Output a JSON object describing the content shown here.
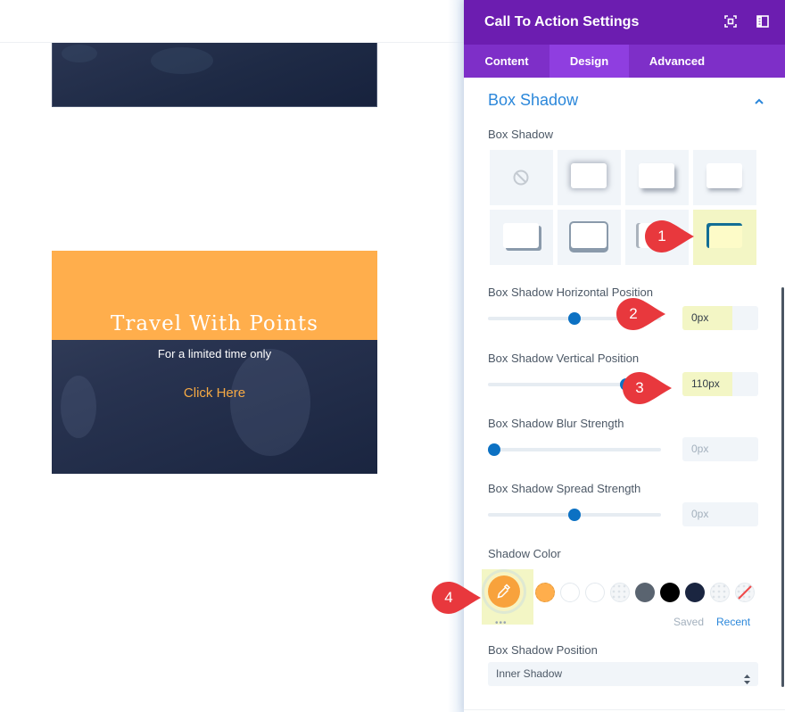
{
  "canvas": {
    "cta": {
      "title": "Travel With Points",
      "subtitle": "For a limited time only",
      "button_label": "Click Here"
    },
    "colors": {
      "shadow_color": "#ffae4c",
      "module_bg": "#1e2a45",
      "button_text": "#f5a944"
    }
  },
  "panel": {
    "title": "Call To Action Settings",
    "header_icons": [
      "expand-icon",
      "sidebar-toggle-icon"
    ],
    "tabs": [
      {
        "label": "Content",
        "active": false
      },
      {
        "label": "Design",
        "active": true
      },
      {
        "label": "Advanced",
        "active": false
      }
    ],
    "section": {
      "title": "Box Shadow",
      "expanded": true,
      "presets_label": "Box Shadow",
      "presets": [
        "none",
        "all-around",
        "bottom-right",
        "bottom",
        "bottom-right-hard",
        "bottom-hard",
        "left-hard",
        "inner-top-left"
      ],
      "selected_preset": 7,
      "horizontal": {
        "label": "Box Shadow Horizontal Position",
        "value": "0px",
        "slider_fraction": 0.5
      },
      "vertical": {
        "label": "Box Shadow Vertical Position",
        "value": "110px",
        "slider_fraction": 0.82
      },
      "blur": {
        "label": "Box Shadow Blur Strength",
        "value": "0px",
        "slider_fraction": 0.0
      },
      "spread": {
        "label": "Box Shadow Spread Strength",
        "value": "0px",
        "slider_fraction": 0.5
      },
      "shadow_color": {
        "label": "Shadow Color",
        "current": "#f8a23c",
        "more_label": "•••",
        "swatches": [
          "#ffae4c",
          "#ffffff",
          "#ffffff",
          "transparent",
          "#5a6470",
          "#000000",
          "#1a2540",
          "transparent",
          "none"
        ],
        "saved_label": "Saved",
        "recent_label": "Recent"
      },
      "position": {
        "label": "Box Shadow Position",
        "value": "Inner Shadow"
      }
    },
    "colors": {
      "header_bg": "#6c1db0",
      "tabs_bg": "#7e2fc8",
      "tab_active_bg": "#8f3ee0",
      "accent": "#2b87da",
      "slider": "#0c71c3"
    }
  },
  "annotations": [
    {
      "number": "1",
      "target": "selected-preset"
    },
    {
      "number": "2",
      "target": "horizontal-value"
    },
    {
      "number": "3",
      "target": "vertical-value"
    },
    {
      "number": "4",
      "target": "shadow-color-picker"
    }
  ]
}
